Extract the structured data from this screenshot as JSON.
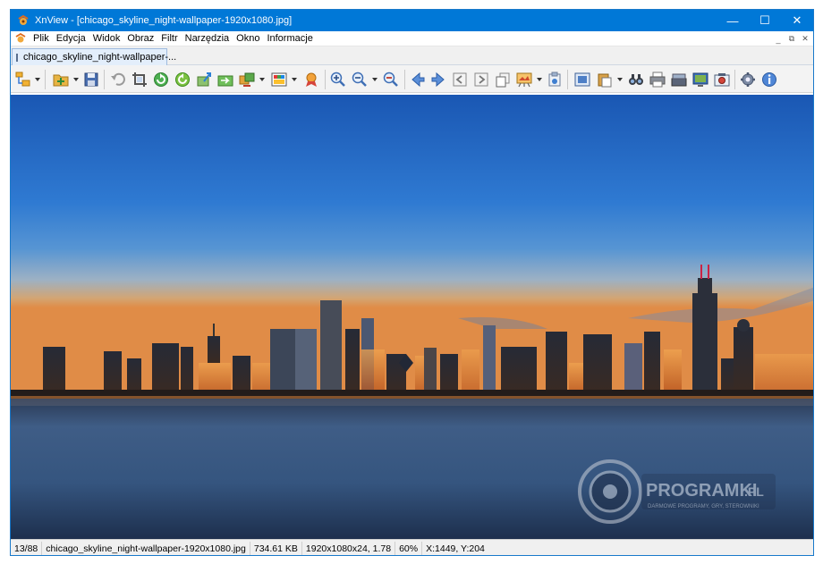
{
  "window": {
    "app_name": "XnView",
    "title": "XnView - [chicago_skyline_night-wallpaper-1920x1080.jpg]",
    "controls": {
      "minimize": "—",
      "maximize": "☐",
      "close": "✕"
    }
  },
  "menu": {
    "items": [
      "Plik",
      "Edycja",
      "Widok",
      "Obraz",
      "Filtr",
      "Narzędzia",
      "Okno",
      "Informacje"
    ],
    "mdi_controls": {
      "minimize": "_",
      "restore": "⧉",
      "close": "✕"
    }
  },
  "tabs": [
    {
      "label": "chicago_skyline_night-wallpaper-...",
      "active": true
    }
  ],
  "toolbar": {
    "buttons": [
      {
        "name": "browser-icon",
        "has_dropdown": true
      },
      {
        "name": "open-folder-icon",
        "has_dropdown": true
      },
      {
        "name": "save-icon"
      },
      {
        "name": "undo-icon"
      },
      {
        "name": "crop-icon"
      },
      {
        "name": "rotate-left-icon"
      },
      {
        "name": "rotate-right-icon"
      },
      {
        "name": "export-icon"
      },
      {
        "name": "convert-icon"
      },
      {
        "name": "batch-icon",
        "has_dropdown": true
      },
      {
        "name": "palette-icon",
        "has_dropdown": true
      },
      {
        "name": "effects-icon"
      },
      {
        "name": "zoom-in-icon"
      },
      {
        "name": "zoom-actual-icon",
        "has_dropdown": true
      },
      {
        "name": "zoom-out-icon"
      },
      {
        "name": "previous-icon"
      },
      {
        "name": "next-icon"
      },
      {
        "name": "first-page-icon"
      },
      {
        "name": "next-page-icon"
      },
      {
        "name": "copy-icon"
      },
      {
        "name": "slideshow-icon",
        "has_dropdown": true
      },
      {
        "name": "properties-icon"
      },
      {
        "name": "fullscreen-icon"
      },
      {
        "name": "clipboard-icon",
        "has_dropdown": true
      },
      {
        "name": "find-icon"
      },
      {
        "name": "print-icon"
      },
      {
        "name": "scanner-icon"
      },
      {
        "name": "capture-icon"
      },
      {
        "name": "webcam-icon"
      },
      {
        "name": "settings-icon"
      },
      {
        "name": "info-icon"
      }
    ]
  },
  "image": {
    "description_alt": "",
    "watermark": {
      "brand": "PROGRAMKI",
      "suffix": ".PL",
      "tagline": "DARMOWE PROGRAMY, GRY, STEROWNIKI"
    }
  },
  "status": {
    "index": "13/88",
    "filename": "chicago_skyline_night-wallpaper-1920x1080.jpg",
    "filesize": "734.61 KB",
    "dimensions": "1920x1080x24, 1.78",
    "zoom": "60%",
    "cursor": "X:1449, Y:204"
  },
  "colors": {
    "titlebar": "#0078d7",
    "accent": "#1979ca"
  }
}
